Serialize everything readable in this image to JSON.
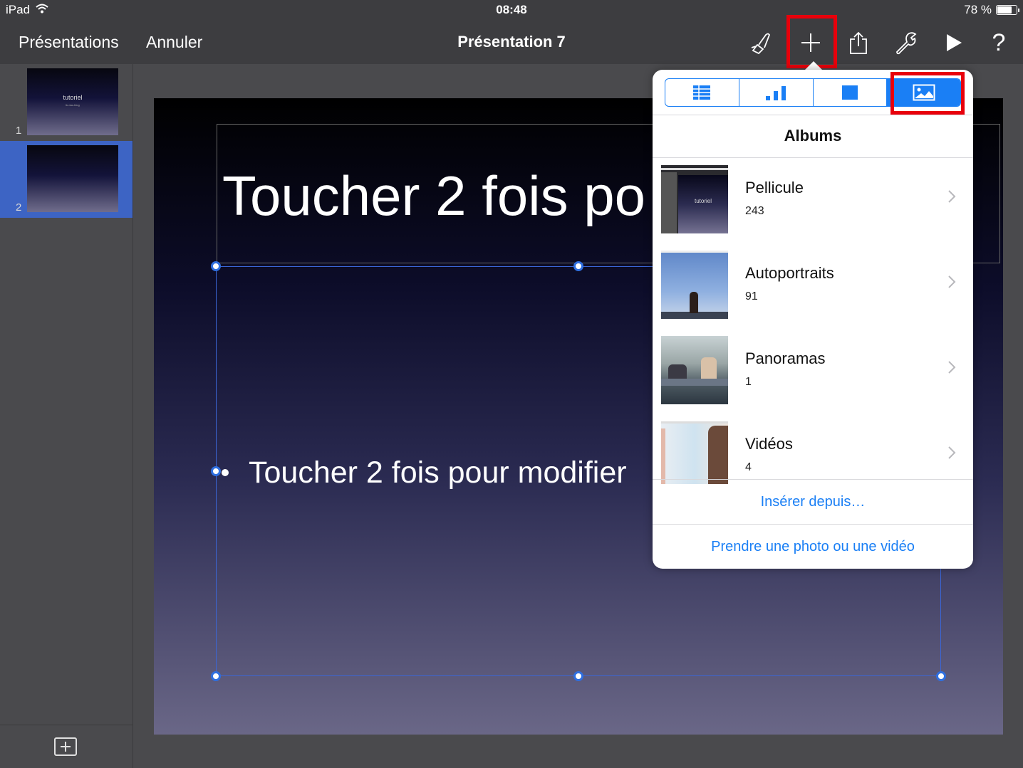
{
  "status": {
    "device": "iPad",
    "time": "08:48",
    "battery": "78 %",
    "battery_level": 0.78
  },
  "toolbar": {
    "back_label": "Présentations",
    "undo_label": "Annuler",
    "title": "Présentation 7",
    "icons": [
      "brush-icon",
      "plus-icon",
      "share-icon",
      "wrench-icon",
      "play-icon",
      "help-icon"
    ],
    "help_glyph": "?"
  },
  "sidebar": {
    "slides": [
      {
        "number": "1",
        "title": "tutoriel",
        "subtitle": "tic-tac-blog"
      },
      {
        "number": "2",
        "title": "",
        "subtitle": ""
      }
    ],
    "add_glyph": "+"
  },
  "slide": {
    "title_placeholder": "Toucher 2 fois po",
    "body_placeholder": "Toucher 2 fois pour modifier"
  },
  "popover": {
    "tabs": [
      "table-icon",
      "chart-icon",
      "shape-icon",
      "media-icon"
    ],
    "active_tab": 3,
    "heading": "Albums",
    "albums": [
      {
        "name": "Pellicule",
        "count": "243"
      },
      {
        "name": "Autoportraits",
        "count": "91"
      },
      {
        "name": "Panoramas",
        "count": "1"
      },
      {
        "name": "Vidéos",
        "count": "4"
      }
    ],
    "pellicule_thumb_text": "tutoriel",
    "insert_from": "Insérer depuis…",
    "take_photo": "Prendre une photo ou une vidéo"
  },
  "colors": {
    "accent": "#1a7ff5",
    "highlight": "#e8000b",
    "toolbar_bg": "#3d3d40",
    "selected_slide": "#3d64c4"
  }
}
